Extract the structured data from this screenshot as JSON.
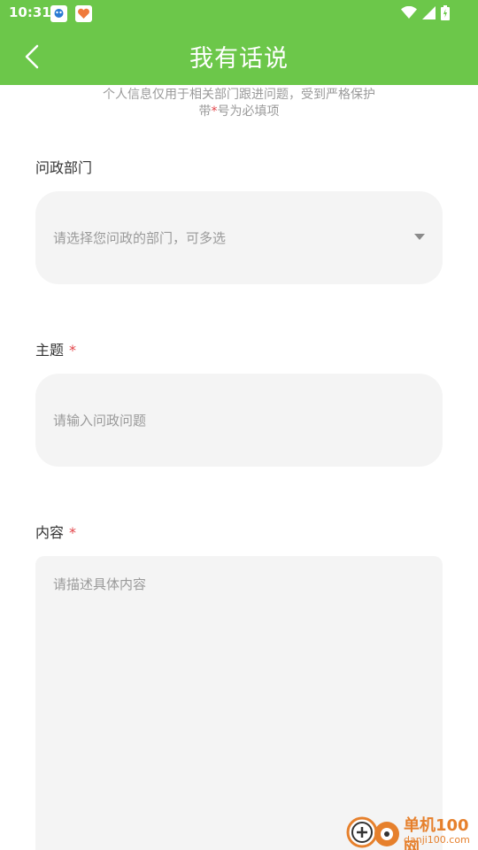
{
  "status_bar": {
    "time": "10:31",
    "icons": [
      "notification-app-icon",
      "notification-heart-icon",
      "wifi-icon",
      "signal-icon",
      "battery-icon"
    ]
  },
  "header": {
    "title": "我有话说",
    "background": "#6cc74a"
  },
  "notice": {
    "line1": "个人信息仅用于相关部门跟进问题，受到严格保护",
    "line2_prefix": "带",
    "line2_star": "*",
    "line2_suffix": "号为必填项"
  },
  "form": {
    "department": {
      "label": "问政部门",
      "placeholder": "请选择您问政的部门，可多选"
    },
    "subject": {
      "label": "主题",
      "required_mark": "*",
      "placeholder": "请输入问政问题"
    },
    "content": {
      "label": "内容",
      "required_mark": "*",
      "placeholder": "请描述具体内容"
    }
  },
  "watermark": {
    "name": "单机100网",
    "url": "danji100.com"
  },
  "colors": {
    "accent": "#6cc74a",
    "required": "#e3454a",
    "field_bg": "#f4f4f4",
    "watermark": "#e6802c"
  }
}
